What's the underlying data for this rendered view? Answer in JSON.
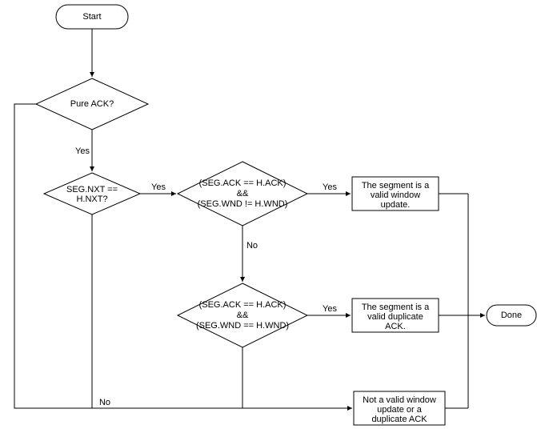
{
  "nodes": {
    "start": "Start",
    "d1": "Pure ACK?",
    "d2_l1": "SEG.NXT ==",
    "d2_l2": "H.NXT?",
    "d3_l1": "(SEG.ACK == H.ACK)",
    "d3_l2": "&&",
    "d3_l3": "(SEG.WND != H.WND)",
    "d4_l1": "(SEG.ACK == H.ACK)",
    "d4_l2": "&&",
    "d4_l3": "(SEG.WND == H.WND)",
    "p1_l1": "The segment is a",
    "p1_l2": "valid window",
    "p1_l3": "update.",
    "p2_l1": "The segment is a",
    "p2_l2": "valid duplicate",
    "p2_l3": "ACK.",
    "p3_l1": "Not a valid window",
    "p3_l2": "update or a",
    "p3_l3": "duplicate ACK",
    "done": "Done"
  },
  "edges": {
    "yes": "Yes",
    "no": "No"
  }
}
